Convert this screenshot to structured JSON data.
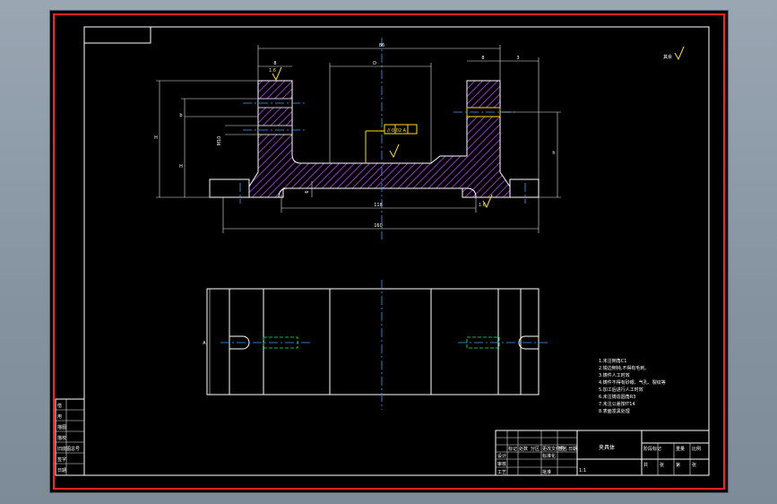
{
  "drawing": {
    "part_name": "夹具体",
    "scale": "1:1",
    "dimensions": {
      "overall_top": "86",
      "left_boss": "8",
      "center_gap": "D",
      "right_boss": "8",
      "right_tab": "3",
      "height_left": "H",
      "height_inner": "H",
      "slot_width": "b",
      "bottom_width": "118",
      "overall_width": "160",
      "thread_callout": "M10",
      "height_right": "h",
      "plan_height": "A"
    },
    "annotations": {
      "roughness_left": "1.6",
      "roughness_bottom": "1.6",
      "roughness_corner": "其余",
      "tolerance_frame": "// 0.02  A"
    },
    "tech_requirements": [
      "1.未注倒角C1",
      "2.锐边倒钝,不得有毛刺。",
      "3.铸件人工时效",
      "4.铸件不得有砂眼、气孔、裂纹等",
      "5.加工后进行人工时效",
      "6.未注铸造圆角R3",
      "7.未注公差按IT14",
      "8.表面发黑处理"
    ],
    "title_block": {
      "left_cells": [
        "标记",
        "处数",
        "分区",
        "更改文件号",
        "签名",
        "日期"
      ],
      "design_row": [
        "设计",
        "标准化"
      ],
      "review_row": [
        "审核",
        "工艺",
        "批准"
      ],
      "stage_labels": [
        "阶段标记",
        "重量",
        "比例"
      ],
      "sheet_labels": [
        "共",
        "张",
        "第",
        "张"
      ]
    },
    "side_table": {
      "rows": [
        "借",
        "用",
        "描图",
        "描校",
        "旧底图总号",
        "签字",
        "日期"
      ]
    }
  }
}
